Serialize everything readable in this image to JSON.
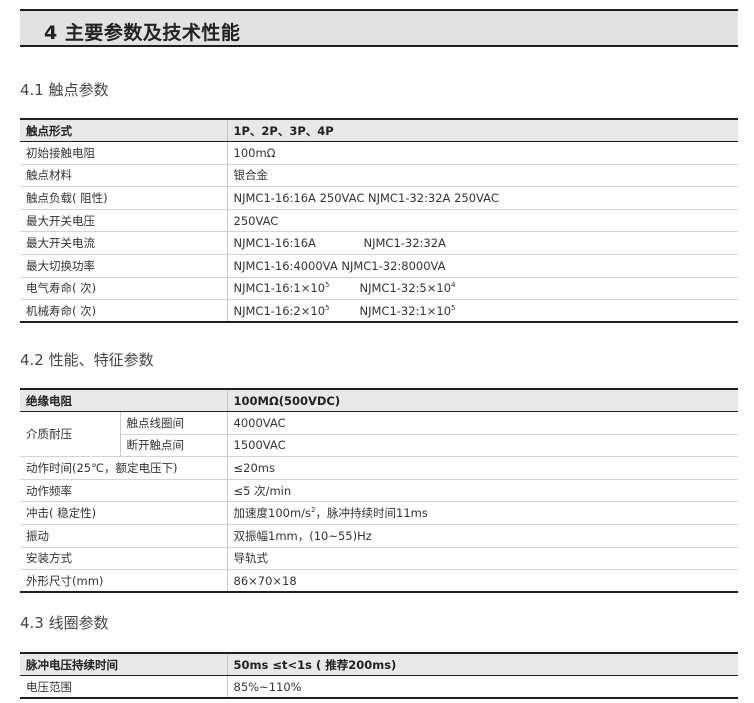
{
  "header": {
    "title": "4 主要参数及技术性能"
  },
  "section1": {
    "title": "4.1 触点参数",
    "head": {
      "label": "触点形式",
      "value": "1P、2P、3P、4P"
    },
    "rows": [
      {
        "label": "初始接触电阻",
        "value": "100mΩ"
      },
      {
        "label": "触点材料",
        "value": "银合金"
      },
      {
        "label": "触点负载( 阻性)",
        "value": "NJMC1-16:16A 250VAC  NJMC1-32:32A 250VAC"
      },
      {
        "label": "最大开关电压",
        "value": "250VAC"
      },
      {
        "label": "最大开关电流",
        "a": "NJMC1-16:16A",
        "b": "NJMC1-32:32A"
      },
      {
        "label": "最大切换功率",
        "value": "NJMC1-16:4000VA  NJMC1-32:8000VA"
      },
      {
        "label": "电气寿命( 次)",
        "a": "NJMC1-16:1×10",
        "a_exp": "5",
        "b": "NJMC1-32:5×10",
        "b_exp": "4"
      },
      {
        "label": "机械寿命( 次)",
        "a": "NJMC1-16:2×10",
        "a_exp": "5",
        "b": "NJMC1-32:1×10",
        "b_exp": "5"
      }
    ]
  },
  "section2": {
    "title": "4.2 性能、特征参数",
    "head": {
      "label": "绝缘电阻",
      "value": "100MΩ(500VDC)"
    },
    "dielectric": {
      "label": "介质耐压",
      "rows": [
        {
          "sub": "触点线圈间",
          "value": "4000VAC"
        },
        {
          "sub": "断开触点间",
          "value": "1500VAC"
        }
      ]
    },
    "rows": [
      {
        "label": "动作时间(25℃，额定电压下)",
        "value": "≤20ms"
      },
      {
        "label": "动作频率",
        "value": "≤5 次/min"
      },
      {
        "label": "冲击( 稳定性)",
        "value_pre": "加速度100m/s",
        "value_exp": "2",
        "value_post": "，脉冲持续时间11ms"
      },
      {
        "label": "振动",
        "value": "双振幅1mm，(10~55)Hz"
      },
      {
        "label": "安装方式",
        "value": "导轨式"
      },
      {
        "label": "外形尺寸(mm)",
        "value": "86×70×18"
      }
    ]
  },
  "section3": {
    "title": "4.3 线圈参数",
    "head": {
      "label": "脉冲电压持续时间",
      "value": "50ms ≤t<1s ( 推荐200ms)"
    },
    "rows": [
      {
        "label": "电压范围",
        "value": "85%~110%"
      }
    ]
  }
}
